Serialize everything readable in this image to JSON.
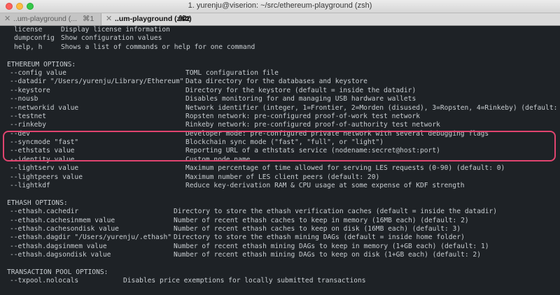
{
  "window": {
    "title": "1. yurenju@viserion: ~/src/ethereum-playground (zsh)",
    "tabs": [
      {
        "label": "..um-playground (...",
        "shortcut": "⌘1",
        "active": false
      },
      {
        "label": "..um-playground (zsh)",
        "shortcut": "⌘2",
        "active": true
      }
    ]
  },
  "terminal": {
    "commands": [
      {
        "option": "license",
        "desc": "Display license information"
      },
      {
        "option": "dumpconfig",
        "desc": "Show configuration values"
      },
      {
        "option": "help, h",
        "desc": "Shows a list of commands or help for one command"
      }
    ],
    "ethereum_header": "ETHEREUM OPTIONS:",
    "ethereum_options": [
      {
        "option": "--config value",
        "desc": "TOML configuration file"
      },
      {
        "option": "--datadir \"/Users/yurenju/Library/Ethereum\"",
        "desc": "Data directory for the databases and keystore"
      },
      {
        "option": "--keystore",
        "desc": "Directory for the keystore (default = inside the datadir)"
      },
      {
        "option": "--nousb",
        "desc": "Disables monitoring for and managing USB hardware wallets"
      },
      {
        "option": "--networkid value",
        "desc": "Network identifier (integer, 1=Frontier, 2=Morden (disused), 3=Ropsten, 4=Rinkeby) (default: 1)"
      },
      {
        "option": "--testnet",
        "desc": "Ropsten network: pre-configured proof-of-work test network"
      },
      {
        "option": "--rinkeby",
        "desc": "Rinkeby network: pre-configured proof-of-authority test network"
      },
      {
        "option": "--dev",
        "desc": "Developer mode: pre-configured private network with several debugging flags"
      },
      {
        "option": "--syncmode \"fast\"",
        "desc": "Blockchain sync mode (\"fast\", \"full\", or \"light\")"
      },
      {
        "option": "--ethstats value",
        "desc": "Reporting URL of a ethstats service (nodename:secret@host:port)"
      },
      {
        "option": "--identity value",
        "desc": "Custom node name"
      },
      {
        "option": "--lightserv value",
        "desc": "Maximum percentage of time allowed for serving LES requests (0-90) (default: 0)"
      },
      {
        "option": "--lightpeers value",
        "desc": "Maximum number of LES client peers (default: 20)"
      },
      {
        "option": "--lightkdf",
        "desc": "Reduce key-derivation RAM & CPU usage at some expense of KDF strength"
      }
    ],
    "ethash_header": "ETHASH OPTIONS:",
    "ethash_options": [
      {
        "option": "--ethash.cachedir",
        "desc": "Directory to store the ethash verification caches (default = inside the datadir)"
      },
      {
        "option": "--ethash.cachesinmem value",
        "desc": "Number of recent ethash caches to keep in memory (16MB each) (default: 2)"
      },
      {
        "option": "--ethash.cachesondisk value",
        "desc": "Number of recent ethash caches to keep on disk (16MB each) (default: 3)"
      },
      {
        "option": "--ethash.dagdir \"/Users/yurenju/.ethash\"",
        "desc": "Directory to store the ethash mining DAGs (default = inside home folder)"
      },
      {
        "option": "--ethash.dagsinmem value",
        "desc": "Number of recent ethash mining DAGs to keep in memory (1+GB each) (default: 1)"
      },
      {
        "option": "--ethash.dagsondisk value",
        "desc": "Number of recent ethash mining DAGs to keep on disk (1+GB each) (default: 2)"
      }
    ],
    "txpool_header": "TRANSACTION POOL OPTIONS:",
    "txpool_options": [
      {
        "option": "--txpool.nolocals",
        "desc": "Disables price exemptions for locally submitted transactions"
      }
    ]
  },
  "highlight_color": "#e0446f"
}
